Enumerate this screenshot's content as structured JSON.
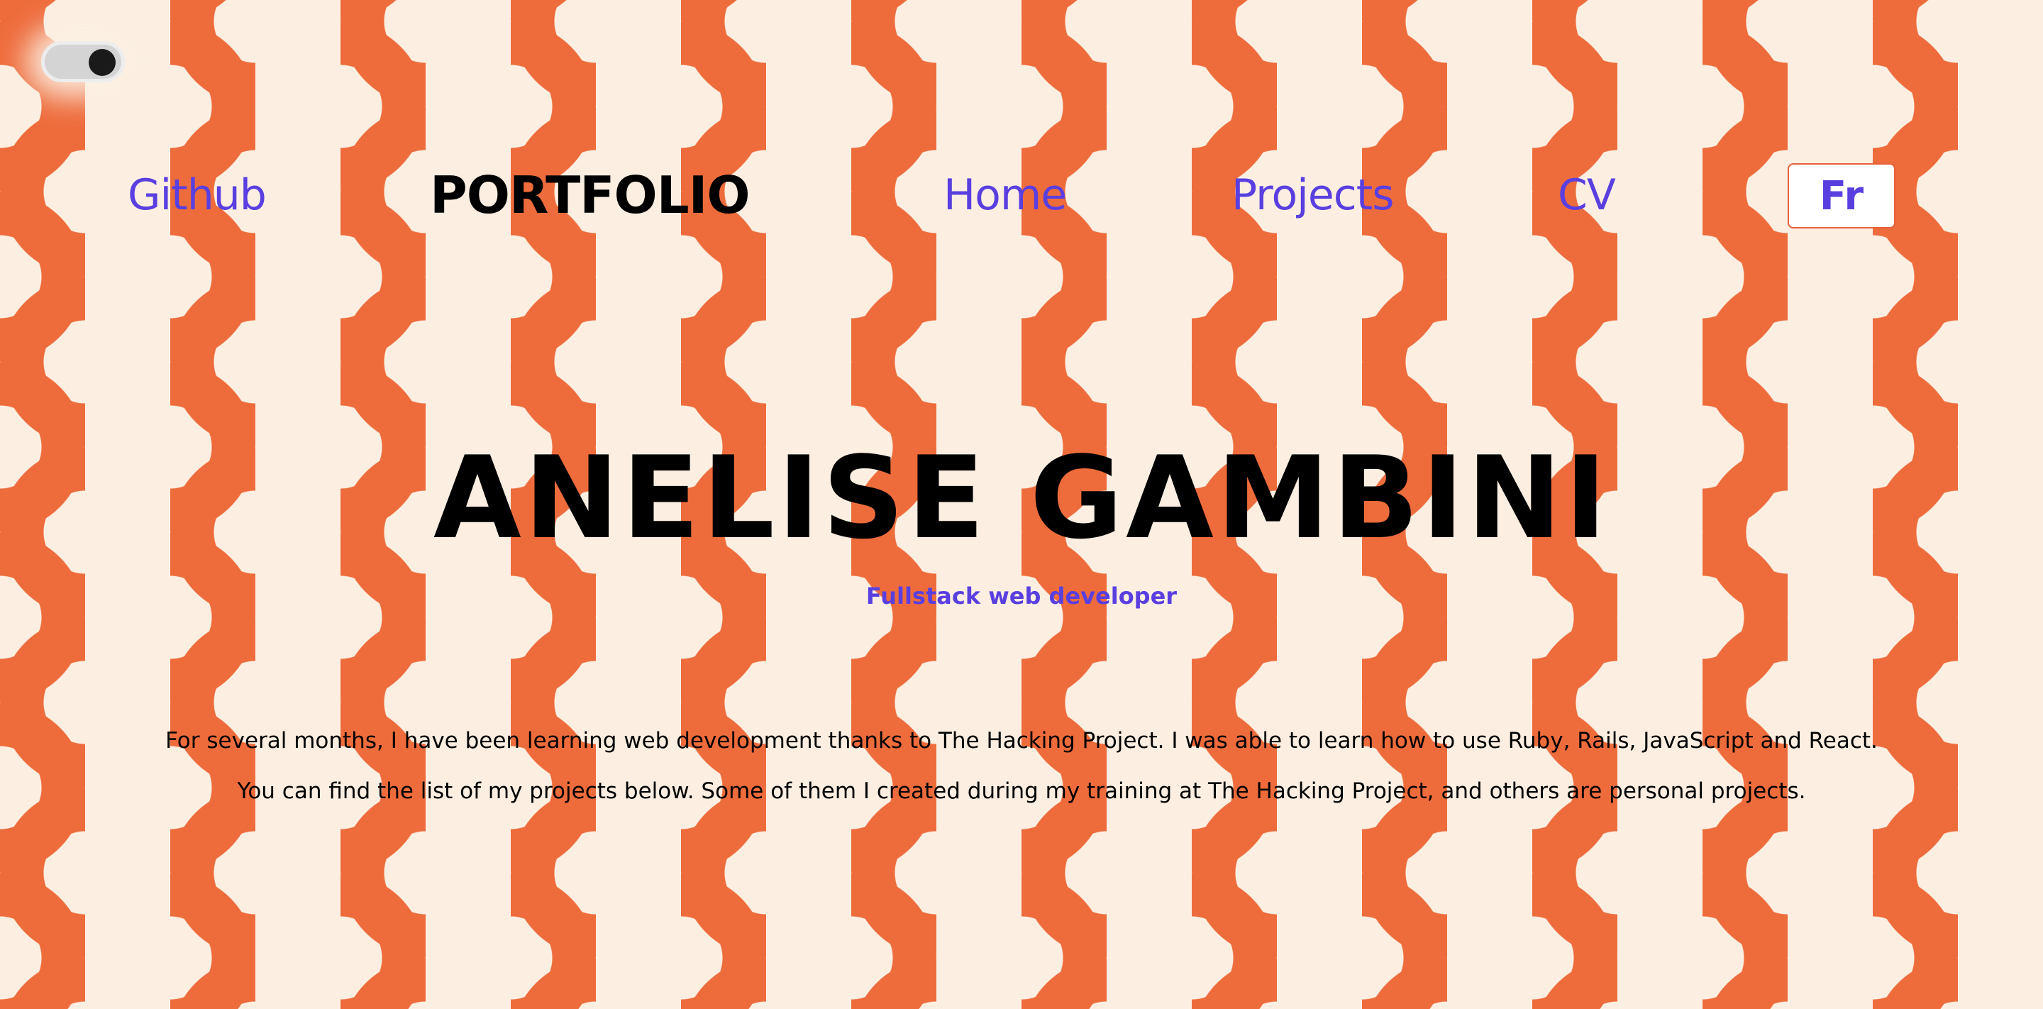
{
  "theme_toggle": {
    "state": "dark-off"
  },
  "nav": {
    "github": "Github",
    "brand": "PORTFOLIO",
    "home": "Home",
    "projects": "Projects",
    "cv": "CV",
    "language": "Fr"
  },
  "hero": {
    "name": "ANELISE GAMBINI",
    "subtitle": "Fullstack web developer"
  },
  "intro": {
    "line1": "For several months, I have been learning web development thanks to The Hacking Project. I was able to learn how to use Ruby, Rails, JavaScript and React.",
    "line2": "You can find the list of my projects below. Some of them I created during my training at The Hacking Project, and others are personal projects."
  },
  "colors": {
    "background": "#fcefe2",
    "pattern": "#ee6c3c",
    "link": "#5a3fe0",
    "text": "#000000"
  }
}
